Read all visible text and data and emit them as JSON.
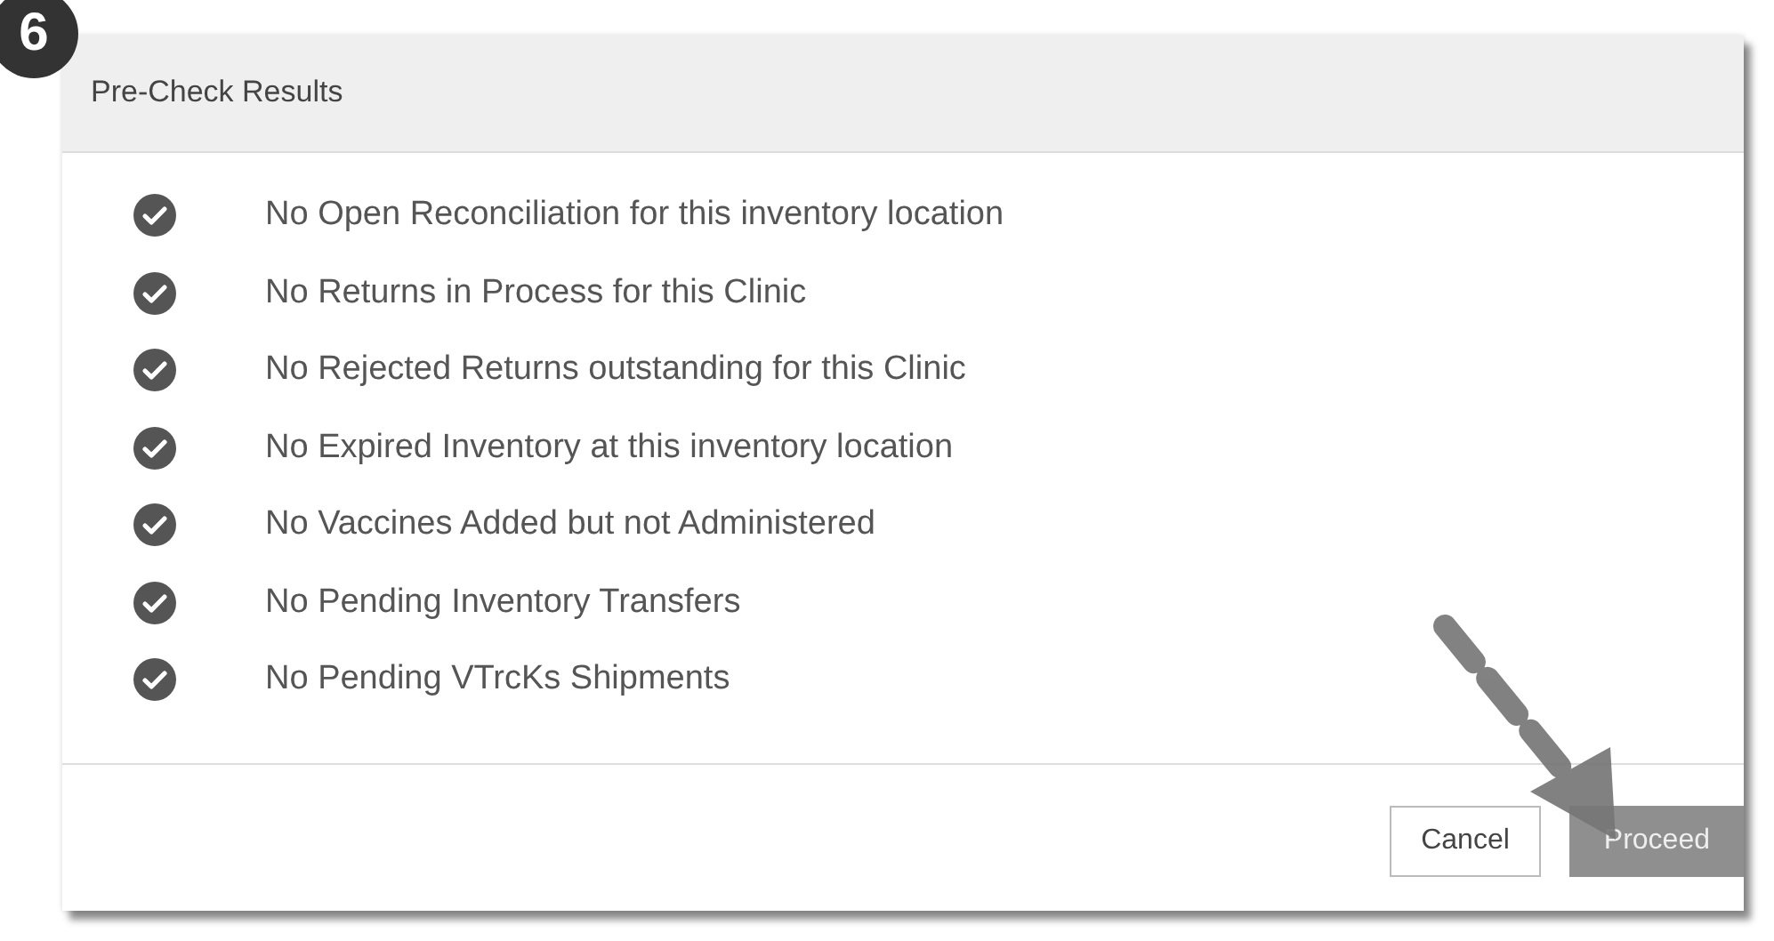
{
  "step_badge": "6",
  "dialog": {
    "title": "Pre-Check Results",
    "checks": [
      {
        "label": "No Open Reconciliation for this inventory location",
        "passed": true
      },
      {
        "label": "No Returns in Process for this Clinic",
        "passed": true
      },
      {
        "label": "No Rejected Returns outstanding for this Clinic",
        "passed": true
      },
      {
        "label": "No Expired Inventory at this inventory location",
        "passed": true
      },
      {
        "label": "No Vaccines Added but not Administered",
        "passed": true
      },
      {
        "label": "No Pending Inventory Transfers",
        "passed": true
      },
      {
        "label": "No Pending VTrcKs Shipments",
        "passed": true
      }
    ],
    "buttons": [
      {
        "label": "Cancel",
        "kind": "secondary"
      },
      {
        "label": "Proceed",
        "kind": "primary"
      }
    ]
  }
}
